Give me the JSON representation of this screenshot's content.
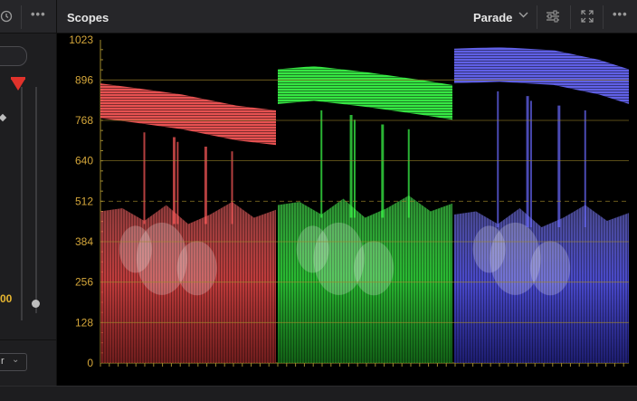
{
  "left": {
    "gain_value": "00",
    "dropdown_label": "r",
    "colors": {
      "marker": "#e0322b",
      "value_text": "#e8b730"
    }
  },
  "scopes": {
    "title": "Scopes",
    "mode": "Parade",
    "icons": [
      "chevron-down-icon",
      "settings-sliders-icon",
      "expand-icon",
      "more-icon"
    ],
    "axis_ticks": [
      "1023",
      "896",
      "768",
      "640",
      "512",
      "384",
      "256",
      "128",
      "0"
    ],
    "colors": {
      "tick_text": "#d4a63a",
      "gridline": "#a08a2c",
      "red": "#ff5a5a",
      "green": "#3cff4a",
      "blue": "#6a6aff"
    }
  },
  "chart_data": {
    "type": "parade",
    "y_range": [
      0,
      1023
    ],
    "y_ticks": [
      0,
      128,
      256,
      384,
      512,
      640,
      768,
      896,
      1023
    ],
    "grid": true,
    "series": [
      {
        "color": "#ff5a5a"
      },
      {
        "color": "#3cff4a"
      },
      {
        "color": "#6a6aff"
      }
    ]
  }
}
